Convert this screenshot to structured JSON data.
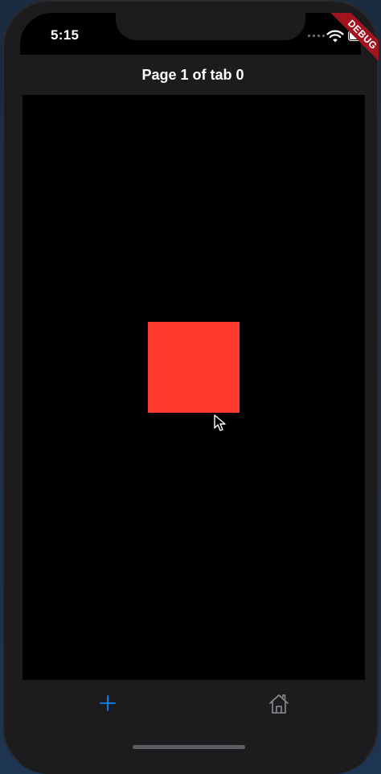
{
  "status_bar": {
    "time": "5:15"
  },
  "debug_banner": {
    "label": "DEBUG"
  },
  "nav": {
    "title": "Page 1 of tab 0"
  },
  "content": {
    "square_color": "#ff3b30",
    "background_color": "#000000"
  },
  "tab_bar": {
    "items": [
      {
        "icon": "plus-icon",
        "active": true,
        "color": "#0a84ff"
      },
      {
        "icon": "home-icon",
        "active": false,
        "color": "#8e8e93"
      }
    ]
  },
  "colors": {
    "accent": "#0a84ff",
    "inactive": "#8e8e93",
    "debug_ribbon": "#a1131f"
  }
}
